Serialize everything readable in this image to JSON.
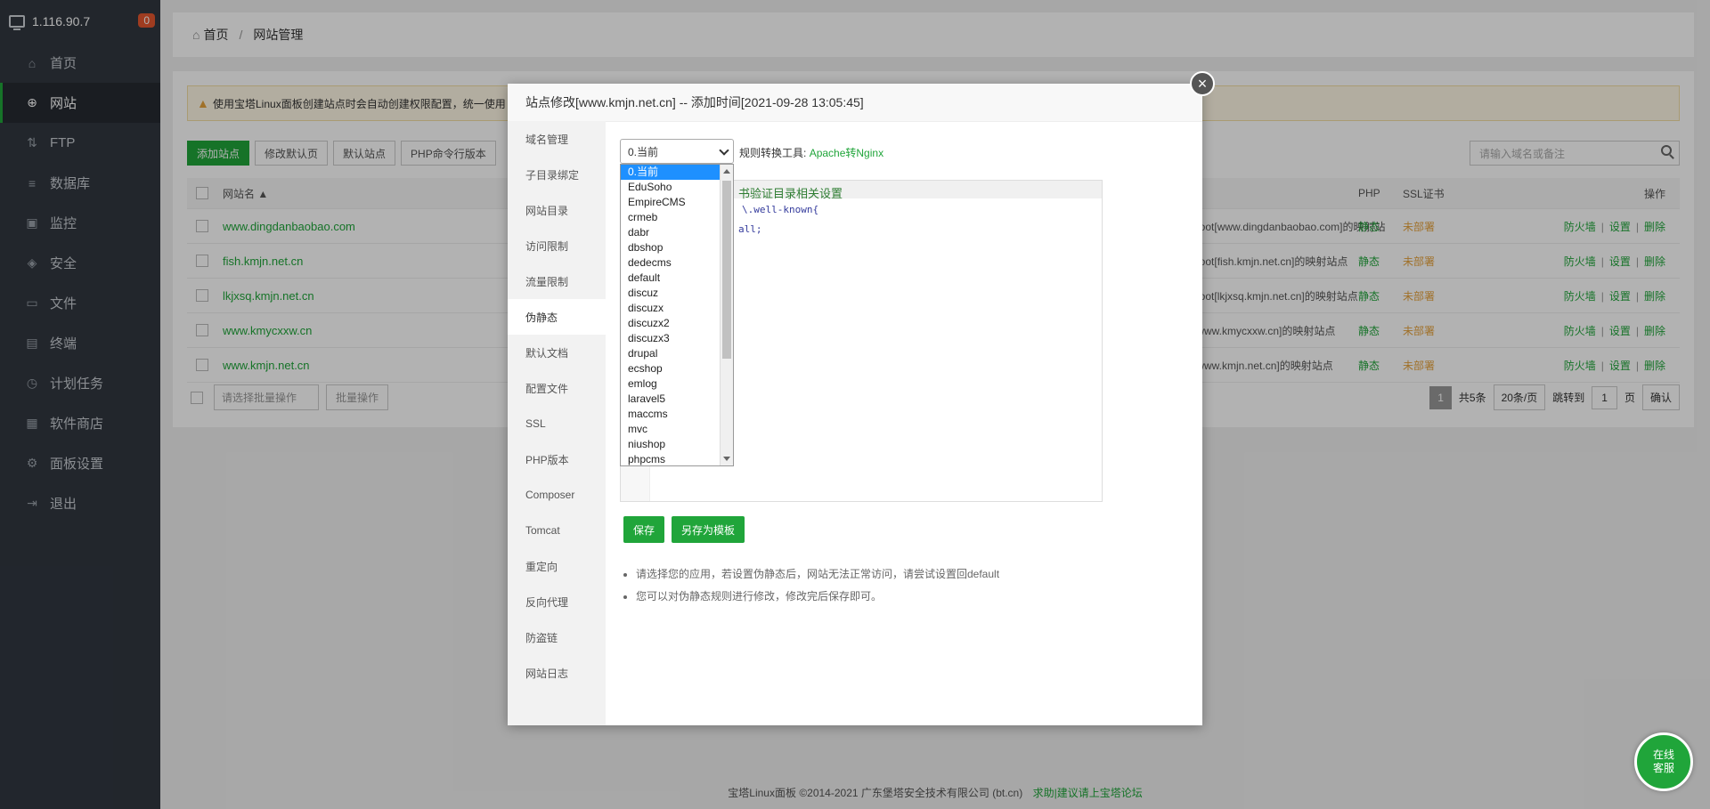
{
  "sidebar": {
    "ip": "1.116.90.7",
    "badge": "0",
    "items": [
      {
        "label": "首页",
        "icon": "home-icon",
        "glyph": "⌂"
      },
      {
        "label": "网站",
        "icon": "globe-icon",
        "glyph": "⊕"
      },
      {
        "label": "FTP",
        "icon": "ftp-icon",
        "glyph": "⇅"
      },
      {
        "label": "数据库",
        "icon": "database-icon",
        "glyph": "≡"
      },
      {
        "label": "监控",
        "icon": "monitor-icon",
        "glyph": "▣"
      },
      {
        "label": "安全",
        "icon": "shield-icon",
        "glyph": "◈"
      },
      {
        "label": "文件",
        "icon": "folder-icon",
        "glyph": "▭"
      },
      {
        "label": "终端",
        "icon": "terminal-icon",
        "glyph": "▤"
      },
      {
        "label": "计划任务",
        "icon": "clock-icon",
        "glyph": "◷"
      },
      {
        "label": "软件商店",
        "icon": "grid-icon",
        "glyph": "▦"
      },
      {
        "label": "面板设置",
        "icon": "gear-icon",
        "glyph": "⚙"
      },
      {
        "label": "退出",
        "icon": "logout-icon",
        "glyph": "⇥"
      }
    ]
  },
  "breadcrumb": {
    "home": "首页",
    "current": "网站管理"
  },
  "notice": "使用宝塔Linux面板创建站点时会自动创建权限配置，统一使用",
  "toolbar": {
    "add": "添加站点",
    "edit_default": "修改默认页",
    "default_site": "默认站点",
    "php_cli": "PHP命令行版本"
  },
  "search_placeholder": "请输入域名或备注",
  "table": {
    "headers": {
      "name": "网站名 ▲",
      "php": "PHP",
      "ssl": "SSL证书",
      "ops": "操作"
    },
    "rows": [
      {
        "name": "www.dingdanbaobao.com",
        "note": "boot[www.dingdanbaobao.com]的映射站",
        "php": "静态",
        "ssl": "未部署"
      },
      {
        "name": "fish.kmjn.net.cn",
        "note": "boot[fish.kmjn.net.cn]的映射站点",
        "php": "静态",
        "ssl": "未部署"
      },
      {
        "name": "lkjxsq.kmjn.net.cn",
        "note": "boot[lkjxsq.kmjn.net.cn]的映射站点",
        "php": "静态",
        "ssl": "未部署"
      },
      {
        "name": "www.kmycxxw.cn",
        "note": "[www.kmycxxw.cn]的映射站点",
        "php": "静态",
        "ssl": "未部署"
      },
      {
        "name": "www.kmjn.net.cn",
        "note": "[www.kmjn.net.cn]的映射站点",
        "php": "静态",
        "ssl": "未部署"
      }
    ],
    "ops": {
      "firewall": "防火墙",
      "settings": "设置",
      "delete": "删除"
    }
  },
  "batch": {
    "select": "请选择批量操作",
    "button": "批量操作"
  },
  "pager": {
    "current": "1",
    "total": "共5条",
    "per_page": "20条/页",
    "jump": "跳转到",
    "page_value": "1",
    "page_unit": "页",
    "confirm": "确认"
  },
  "footer": {
    "copyright": "宝塔Linux面板 ©2014-2021 广东堡塔安全技术有限公司 (bt.cn)",
    "link": "求助|建议请上宝塔论坛"
  },
  "modal": {
    "title": "站点修改[www.kmjn.net.cn] -- 添加时间[2021-09-28 13:05:45]",
    "close": "×",
    "nav": [
      "域名管理",
      "子目录绑定",
      "网站目录",
      "访问限制",
      "流量限制",
      "伪静态",
      "默认文档",
      "配置文件",
      "SSL",
      "PHP版本",
      "Composer",
      "Tomcat",
      "重定向",
      "反向代理",
      "防盗链",
      "网站日志"
    ],
    "rewrite_selected": "0.当前",
    "convert_label": "规则转换工具:",
    "convert_link": "Apache转Nginx",
    "editor_lines": [
      "书验证目录相关设置",
      "\\.well-known{",
      "all;"
    ],
    "options": [
      "0.当前",
      "EduSoho",
      "EmpireCMS",
      "crmeb",
      "dabr",
      "dbshop",
      "dedecms",
      "default",
      "discuz",
      "discuzx",
      "discuzx2",
      "discuzx3",
      "drupal",
      "ecshop",
      "emlog",
      "laravel5",
      "maccms",
      "mvc",
      "niushop",
      "phpcms"
    ],
    "save": "保存",
    "save_template": "另存为模板",
    "tips": [
      "请选择您的应用，若设置伪静态后，网站无法正常访问，请尝试设置回default",
      "您可以对伪静态规则进行修改，修改完后保存即可。"
    ]
  },
  "chat": {
    "line1": "在线",
    "line2": "客服"
  }
}
